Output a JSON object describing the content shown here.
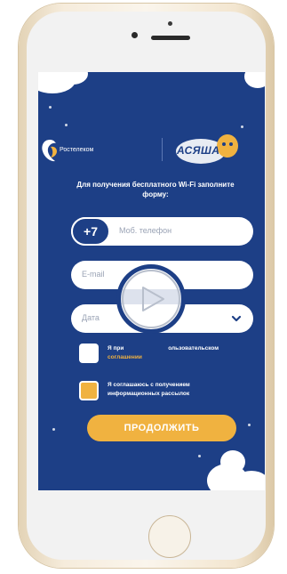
{
  "colors": {
    "brand_blue": "#1d3f86",
    "accent_orange": "#f0b240",
    "white": "#ffffff"
  },
  "logos": {
    "rostelecom": "Ростелеком",
    "asha": "АСЯША"
  },
  "intro_text": "Для получения бесплатного Wi-Fi заполните форму:",
  "form": {
    "phone_prefix": "+7",
    "phone_placeholder": "Моб. телефон",
    "email_placeholder": "E-mail",
    "date_placeholder": "Дата",
    "checkbox_terms_lead": "Я при",
    "checkbox_terms_mid": "ользовательском",
    "checkbox_terms_link": "соглашении",
    "checkbox_news": "Я соглашаюсь с получением информационных рассылок",
    "submit_label": "ПРОДОЛЖИТЬ",
    "news_checked": true,
    "terms_checked": false
  },
  "icons": {
    "play": "play-icon",
    "chevron": "chevron-down-icon",
    "logo": "rostelecom-logo-icon"
  }
}
